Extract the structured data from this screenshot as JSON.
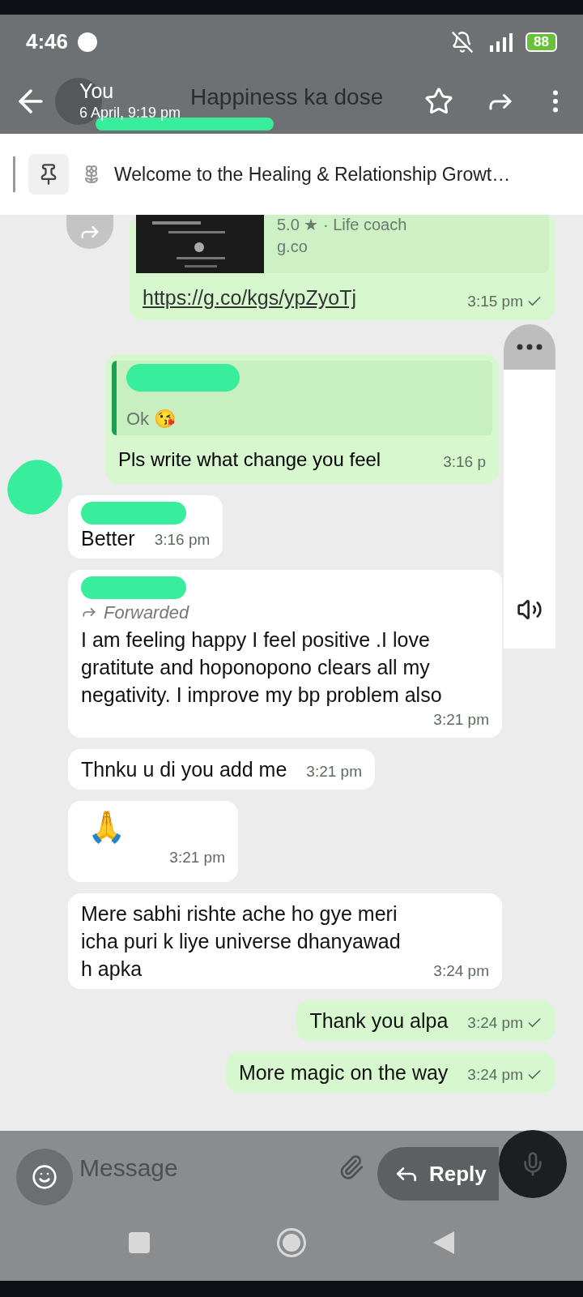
{
  "status_bar": {
    "time": "4:46",
    "battery": "88"
  },
  "header": {
    "sender": "You",
    "timestamp": "6 April, 9:19 pm",
    "group_name": "Happiness ka dose"
  },
  "pinned": {
    "text": "Welcome to the Healing & Relationship Growt…"
  },
  "messages": [
    {
      "kind": "link",
      "outgoing": true,
      "meta": "5.0 ★ · Life coach",
      "domain": "g.co",
      "url": "https://g.co/kgs/ypZyoTj",
      "time": "3:15 pm",
      "tick": true
    },
    {
      "kind": "quote",
      "outgoing": true,
      "quote": "Ok 😘",
      "text": "Pls write what change you feel",
      "time": "3:16 p",
      "tick": false
    },
    {
      "kind": "text",
      "outgoing": false,
      "redacted_sender": true,
      "text": "Better",
      "time": "3:16 pm",
      "tick": false
    },
    {
      "kind": "forwarded",
      "outgoing": false,
      "redacted_sender": true,
      "label": "Forwarded",
      "text": "I am feeling happy I feel positive .I love gratitute and hoponopono clears all my negativity. I improve my bp problem also",
      "time": "3:21 pm",
      "tick": false
    },
    {
      "kind": "text",
      "outgoing": false,
      "text": "Thnku u di you add me",
      "time": "3:21 pm",
      "tick": false
    },
    {
      "kind": "emoji",
      "outgoing": false,
      "text": "🙏",
      "time": "3:21 pm",
      "tick": false
    },
    {
      "kind": "text",
      "outgoing": false,
      "text": "Mere sabhi rishte ache ho gye meri icha puri k liye universe dhanyawad h apka",
      "time": "3:24 pm",
      "tick": false
    },
    {
      "kind": "text",
      "outgoing": true,
      "text": "Thank you  alpa",
      "time": "3:24 pm",
      "tick": true
    },
    {
      "kind": "text",
      "outgoing": true,
      "text": "More magic on the way",
      "time": "3:24 pm",
      "tick": true
    }
  ],
  "composer": {
    "placeholder": "Message"
  },
  "reply_button": {
    "label": "Reply"
  }
}
